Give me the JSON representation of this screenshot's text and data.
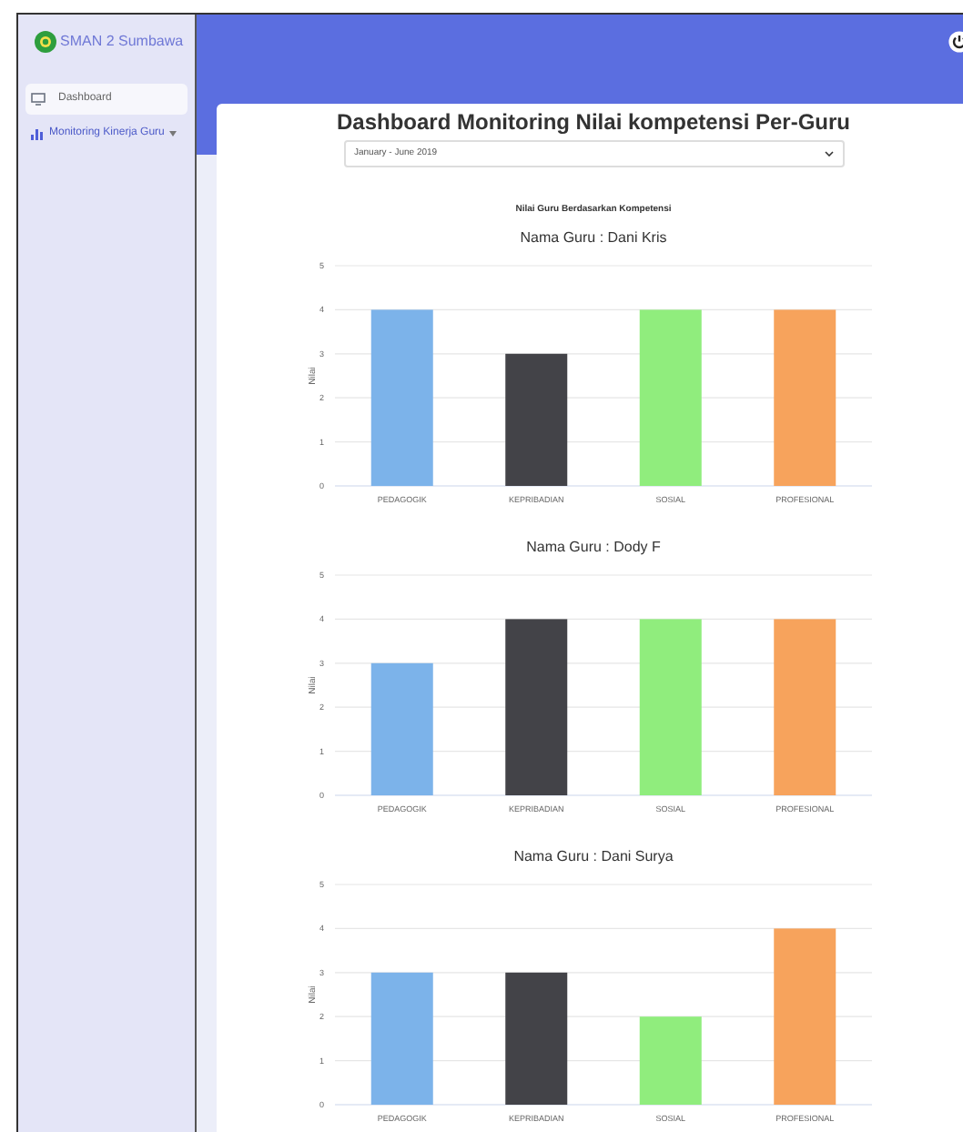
{
  "sidebar": {
    "brand": "SMAN 2 Sumbawa",
    "items": [
      {
        "label": "Dashboard",
        "selected": true,
        "dropdown": false
      },
      {
        "label": "Monitoring Kinerja Guru",
        "selected": false,
        "dropdown": true
      }
    ]
  },
  "page": {
    "title": "Dashboard Monitoring Nilai kompetensi Per-Guru",
    "period_select": {
      "value": "January - June 2019"
    },
    "subtitle": "Nilai Guru Berdasarkan Kompetensi"
  },
  "charts": [
    {
      "chart_data": {
        "type": "bar",
        "title": "Nama Guru : Dani Kris",
        "ylabel": "Nilai",
        "categories": [
          "PEDAGOGIK",
          "KEPRIBADIAN",
          "SOSIAL",
          "PROFESIONAL"
        ],
        "colors": [
          "#7cb3ea",
          "#434348",
          "#90ed7d",
          "#f7a35c"
        ],
        "series": [
          {
            "values": [
              4,
              3,
              4,
              4
            ]
          }
        ],
        "grid": true,
        "ylim": [
          0,
          5
        ],
        "yticks": [
          0,
          1,
          2,
          3,
          4,
          5
        ]
      }
    },
    {
      "chart_data": {
        "type": "bar",
        "title": "Nama Guru : Dody F",
        "ylabel": "Nilai",
        "categories": [
          "PEDAGOGIK",
          "KEPRIBADIAN",
          "SOSIAL",
          "PROFESIONAL"
        ],
        "colors": [
          "#7cb3ea",
          "#434348",
          "#90ed7d",
          "#f7a35c"
        ],
        "series": [
          {
            "values": [
              3,
              4,
              4,
              4
            ]
          }
        ],
        "grid": true,
        "ylim": [
          0,
          5
        ],
        "yticks": [
          0,
          1,
          2,
          3,
          4,
          5
        ]
      }
    },
    {
      "chart_data": {
        "type": "bar",
        "title": "Nama Guru : Dani Surya",
        "ylabel": "Nilai",
        "categories": [
          "PEDAGOGIK",
          "KEPRIBADIAN",
          "SOSIAL",
          "PROFESIONAL"
        ],
        "colors": [
          "#7cb3ea",
          "#434348",
          "#90ed7d",
          "#f7a35c"
        ],
        "series": [
          {
            "values": [
              3,
              3,
              2,
              4
            ]
          }
        ],
        "grid": true,
        "ylim": [
          0,
          5
        ],
        "yticks": [
          0,
          1,
          2,
          3,
          4,
          5
        ]
      }
    }
  ]
}
